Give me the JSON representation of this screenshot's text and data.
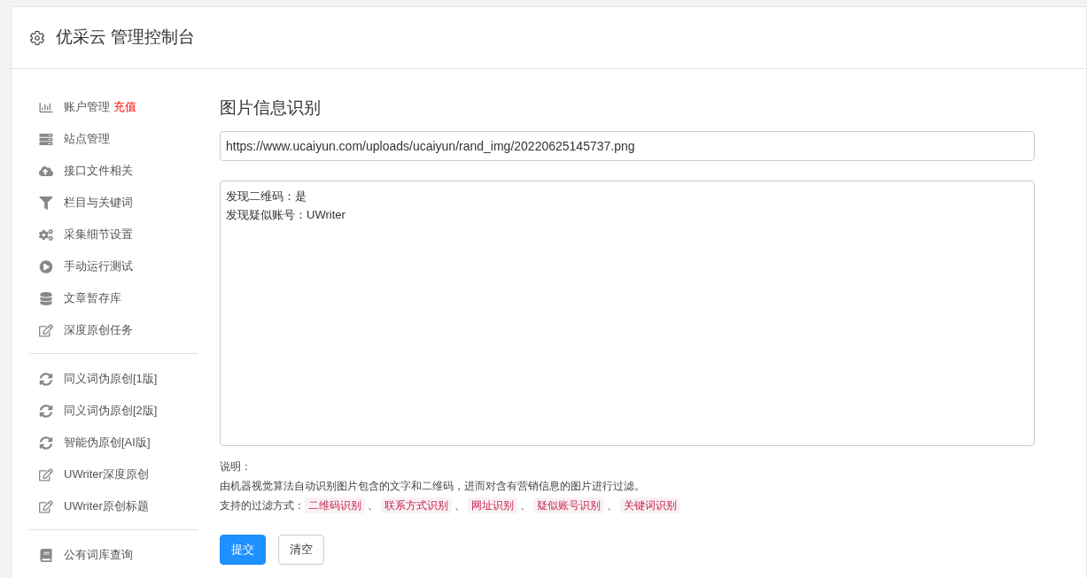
{
  "header": {
    "title": "优采云 管理控制台"
  },
  "sidebar": {
    "groups": [
      [
        {
          "kind": "chart",
          "label": "账户管理",
          "badge": "充值"
        },
        {
          "kind": "server",
          "label": "站点管理"
        },
        {
          "kind": "cloud",
          "label": "接口文件相关"
        },
        {
          "kind": "filter",
          "label": "栏目与关键词"
        },
        {
          "kind": "gears",
          "label": "采集细节设置"
        },
        {
          "kind": "play",
          "label": "手动运行测试"
        },
        {
          "kind": "database",
          "label": "文章暂存库"
        },
        {
          "kind": "edit",
          "label": "深度原创任务"
        }
      ],
      [
        {
          "kind": "refresh",
          "label": "同义词伪原创[1版]"
        },
        {
          "kind": "refresh",
          "label": "同义词伪原创[2版]"
        },
        {
          "kind": "refresh",
          "label": "智能伪原创[AI版]"
        },
        {
          "kind": "edit",
          "label": "UWriter深度原创"
        },
        {
          "kind": "edit",
          "label": "UWriter原创标题"
        }
      ],
      [
        {
          "kind": "book",
          "label": "公有词库查询"
        }
      ]
    ]
  },
  "main": {
    "title": "图片信息识别",
    "url_field": {
      "value": "https://www.ucaiyun.com/uploads/ucaiyun/rand_img/20220625145737.png"
    },
    "result_field": {
      "lines": [
        "发现二维码：是",
        "发现疑似账号：UWriter"
      ]
    },
    "note_label": "说明：",
    "description": "由机器视觉算法自动识别图片包含的文字和二维码，进而对含有营销信息的图片进行过滤。",
    "filters_label": "支持的过滤方式：",
    "filters": [
      {
        "tag": "二维码识别",
        "after": "、"
      },
      {
        "tag": "联系方式识别",
        "after": "、"
      },
      {
        "tag": "网址识别",
        "after": "、"
      },
      {
        "tag": "疑似账号识别",
        "after": "、"
      },
      {
        "tag": "关键词识别"
      }
    ],
    "buttons": [
      {
        "kind": "primary",
        "label": "提交"
      },
      {
        "kind": "default",
        "label": "清空"
      }
    ]
  }
}
